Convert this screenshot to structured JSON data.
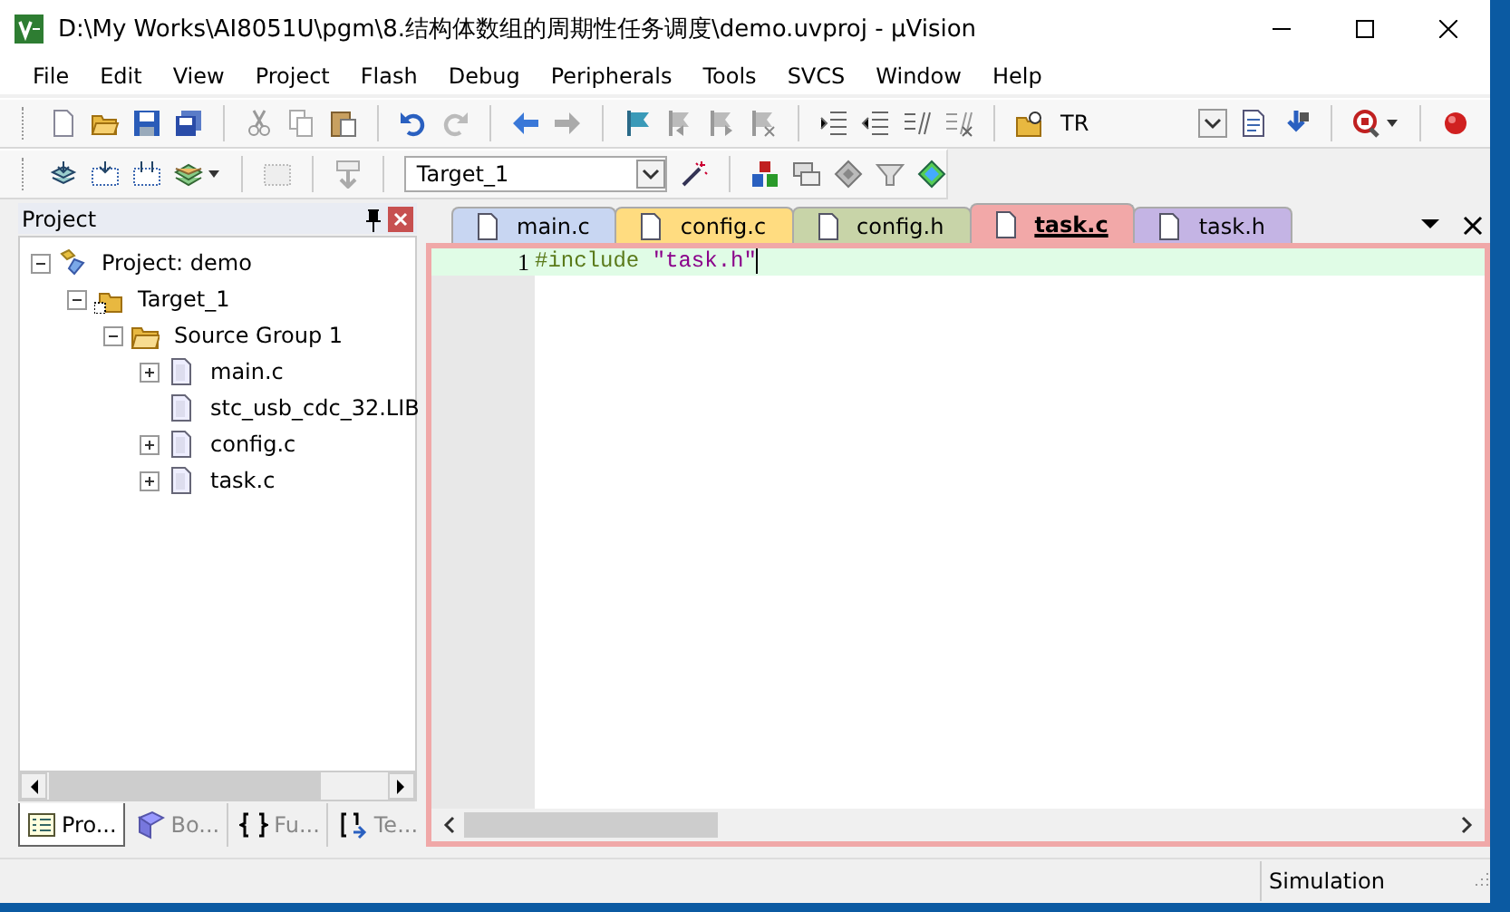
{
  "window": {
    "title": "D:\\My Works\\AI8051U\\pgm\\8.结构体数组的周期性任务调度\\demo.uvproj - µVision"
  },
  "menu": [
    "File",
    "Edit",
    "View",
    "Project",
    "Flash",
    "Debug",
    "Peripherals",
    "Tools",
    "SVCS",
    "Window",
    "Help"
  ],
  "toolbar": {
    "find_text": "TR"
  },
  "build_toolbar": {
    "target": "Target_1"
  },
  "project_panel": {
    "title": "Project",
    "tree": [
      {
        "kind": "project",
        "label": "Project: demo",
        "expanded": true,
        "children": [
          {
            "kind": "target",
            "label": "Target_1",
            "expanded": true,
            "children": [
              {
                "kind": "group",
                "label": "Source Group 1",
                "expanded": true,
                "children": [
                  {
                    "kind": "file",
                    "label": "main.c",
                    "expanded": false
                  },
                  {
                    "kind": "file",
                    "label": "stc_usb_cdc_32.LIB"
                  },
                  {
                    "kind": "file",
                    "label": "config.c",
                    "expanded": false
                  },
                  {
                    "kind": "file",
                    "label": "task.c",
                    "expanded": false
                  }
                ]
              }
            ]
          }
        ]
      }
    ],
    "tabs": [
      {
        "label": "Pro...",
        "selected": true
      },
      {
        "label": "Bo...",
        "selected": false
      },
      {
        "label": "Fu...",
        "selected": false
      },
      {
        "label": "Te...",
        "selected": false
      }
    ]
  },
  "editor": {
    "tabs": [
      {
        "label": "main.c",
        "color": "#c8d6f2",
        "selected": false
      },
      {
        "label": "config.c",
        "color": "#ffdc80",
        "selected": false
      },
      {
        "label": "config.h",
        "color": "#c8d4a8",
        "selected": false
      },
      {
        "label": "task.c",
        "color": "#f2a8a8",
        "selected": true
      },
      {
        "label": "task.h",
        "color": "#c4b4e4",
        "selected": false
      }
    ],
    "lines": [
      {
        "number": "1",
        "directive": "#include",
        "string": "\"task.h\"",
        "current": true
      }
    ]
  },
  "status_bar": {
    "mode": "Simulation"
  }
}
